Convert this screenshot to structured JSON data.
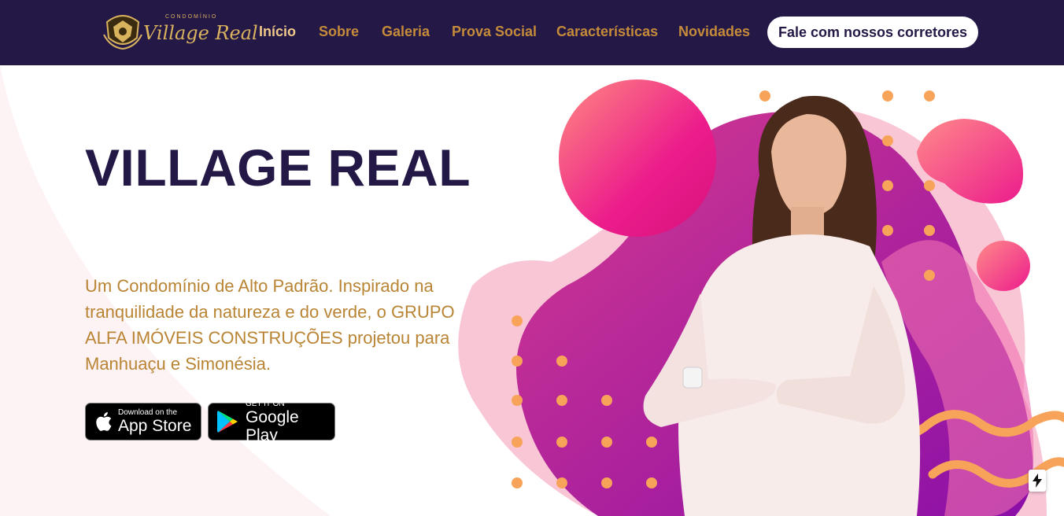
{
  "logo": {
    "subtitle": "CONDOMÍNIO",
    "name": "Village Real"
  },
  "nav": {
    "items": [
      {
        "label": "Início",
        "active": true
      },
      {
        "label": "Sobre",
        "active": false
      },
      {
        "label": "Galeria",
        "active": false
      },
      {
        "label": "Prova Social",
        "active": false
      },
      {
        "label": "Características",
        "active": false
      },
      {
        "label": "Novidades",
        "active": false
      }
    ],
    "cta_label": "Fale com nossos corretores"
  },
  "hero": {
    "title": "VILLAGE REAL",
    "description": "Um Condomínio de Alto Padrão. Inspirado na tranquilidade da natureza e do verde, o GRUPO ALFA IMÓVEIS CONSTRUÇÕES projetou para Manhuaçu e Simonésia."
  },
  "stores": {
    "appstore": {
      "small": "Download on the",
      "big": "App Store",
      "icon": "apple-icon"
    },
    "googleplay": {
      "small": "GET IT ON",
      "big": "Google Play",
      "icon": "google-play-icon"
    }
  },
  "colors": {
    "navbar_bg": "#241846",
    "nav_link": "#c58b3a",
    "nav_active": "#f0c88a",
    "title": "#241846",
    "body_text": "#b98433",
    "blob_pink": "#ec1c8c",
    "blob_purple": "#8a0fa8",
    "dot_orange": "#f8a35a"
  },
  "floating_button": {
    "icon": "bolt-icon"
  }
}
